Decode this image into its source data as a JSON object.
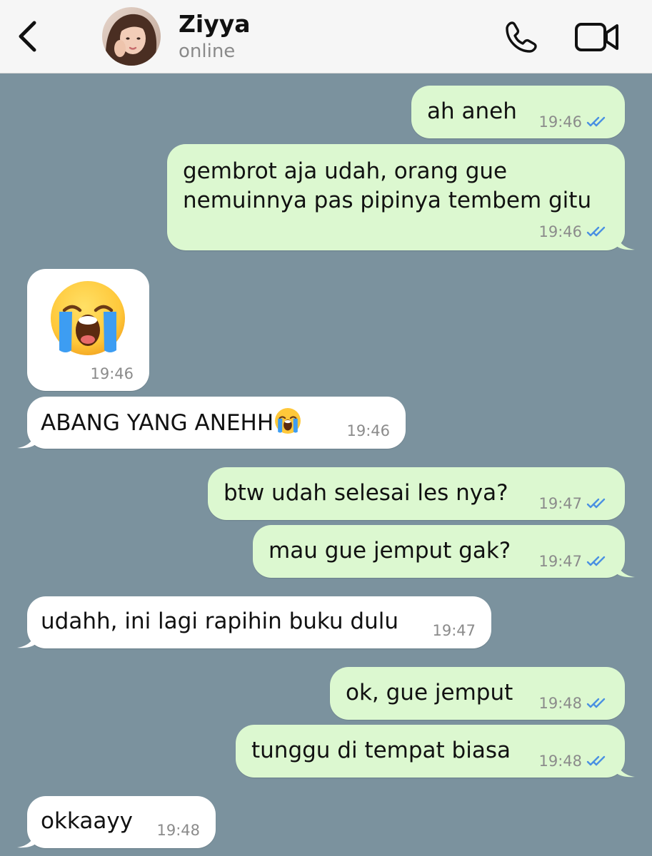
{
  "header": {
    "contact_name": "Ziyya",
    "contact_status": "online",
    "back_icon": "chevron-left-icon",
    "call_icon": "phone-icon",
    "video_icon": "video-camera-icon"
  },
  "colors": {
    "chat_background": "#7b929e",
    "outgoing_bubble": "#dcf8d0",
    "incoming_bubble": "#ffffff",
    "read_ticks": "#4a90e2"
  },
  "messages": [
    {
      "direction": "out",
      "text": "ah aneh",
      "time": "19:46",
      "status": "read"
    },
    {
      "direction": "out",
      "line1": "gembrot aja udah, orang gue",
      "line2": "nemuinnya pas pipinya tembem gitu",
      "time": "19:46",
      "status": "read"
    },
    {
      "direction": "in",
      "emoji": "loudly-crying-face",
      "time": "19:46"
    },
    {
      "direction": "in",
      "text": "ABANG YANG ANEHH",
      "emoji": "loudly-crying-face",
      "time": "19:46"
    },
    {
      "direction": "out",
      "text": "btw udah selesai les nya?",
      "time": "19:47",
      "status": "read"
    },
    {
      "direction": "out",
      "text": "mau gue jemput gak?",
      "time": "19:47",
      "status": "read"
    },
    {
      "direction": "in",
      "text": "udahh, ini lagi rapihin buku dulu",
      "time": "19:47"
    },
    {
      "direction": "out",
      "text": "ok, gue jemput",
      "time": "19:48",
      "status": "read"
    },
    {
      "direction": "out",
      "text": "tunggu di tempat biasa",
      "time": "19:48",
      "status": "read"
    },
    {
      "direction": "in",
      "text": "okkaayy",
      "time": "19:48"
    }
  ]
}
